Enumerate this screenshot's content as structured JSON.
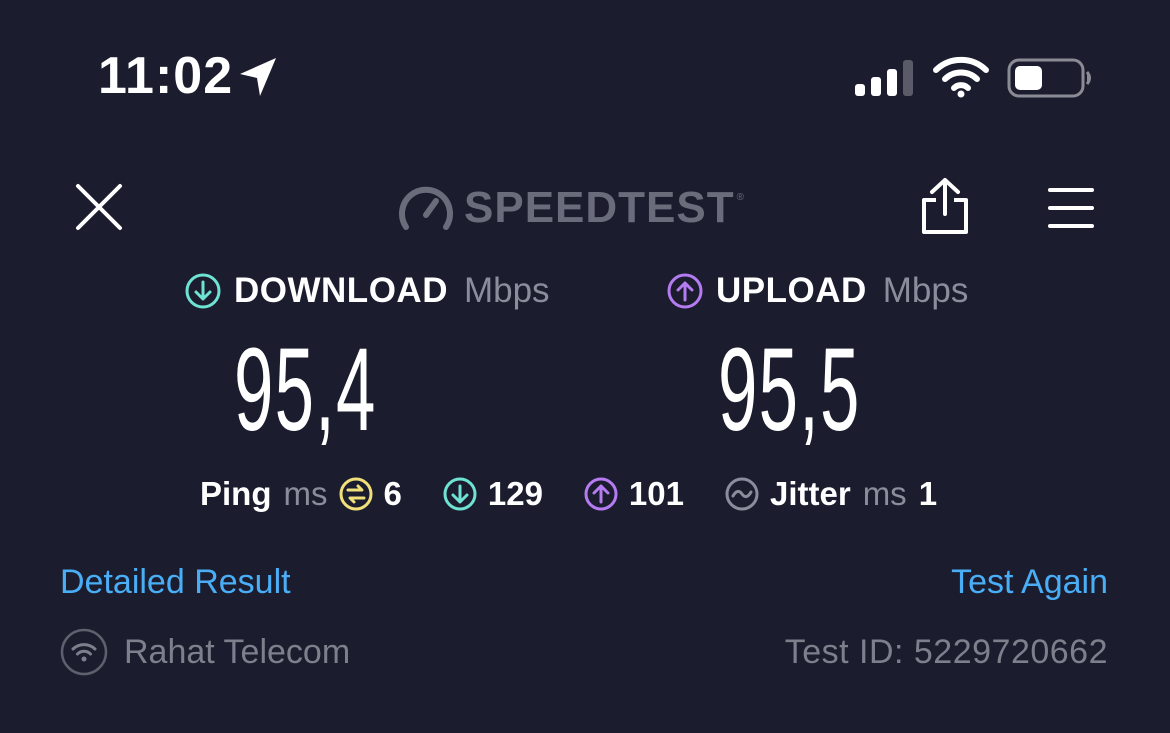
{
  "status_bar": {
    "time": "11:02",
    "icons": [
      "location-arrow-icon",
      "cellular-signal-icon",
      "wifi-icon",
      "battery-icon"
    ]
  },
  "header": {
    "logo_text": "SPEEDTEST",
    "trademark": "®",
    "icons": [
      "close-icon",
      "gauge-logo-icon",
      "share-icon",
      "menu-icon"
    ]
  },
  "download": {
    "label": "DOWNLOAD",
    "unit": "Mbps",
    "value": "95,4",
    "color": "#6fe3d3"
  },
  "upload": {
    "label": "UPLOAD",
    "unit": "Mbps",
    "value": "95,5",
    "color": "#b57cf2"
  },
  "ping": {
    "label": "Ping",
    "unit": "ms",
    "idle": "6",
    "download": "129",
    "upload": "101",
    "idle_color": "#f1e07a"
  },
  "jitter": {
    "label": "Jitter",
    "unit": "ms",
    "value": "1"
  },
  "links": {
    "detailed": "Detailed Result",
    "test_again": "Test Again"
  },
  "provider": {
    "name": "Rahat Telecom"
  },
  "test": {
    "id_text": "Test ID: 5229720662"
  },
  "colors": {
    "background": "#1b1c2d",
    "link": "#4aaef7",
    "muted": "#8b8d9c"
  }
}
